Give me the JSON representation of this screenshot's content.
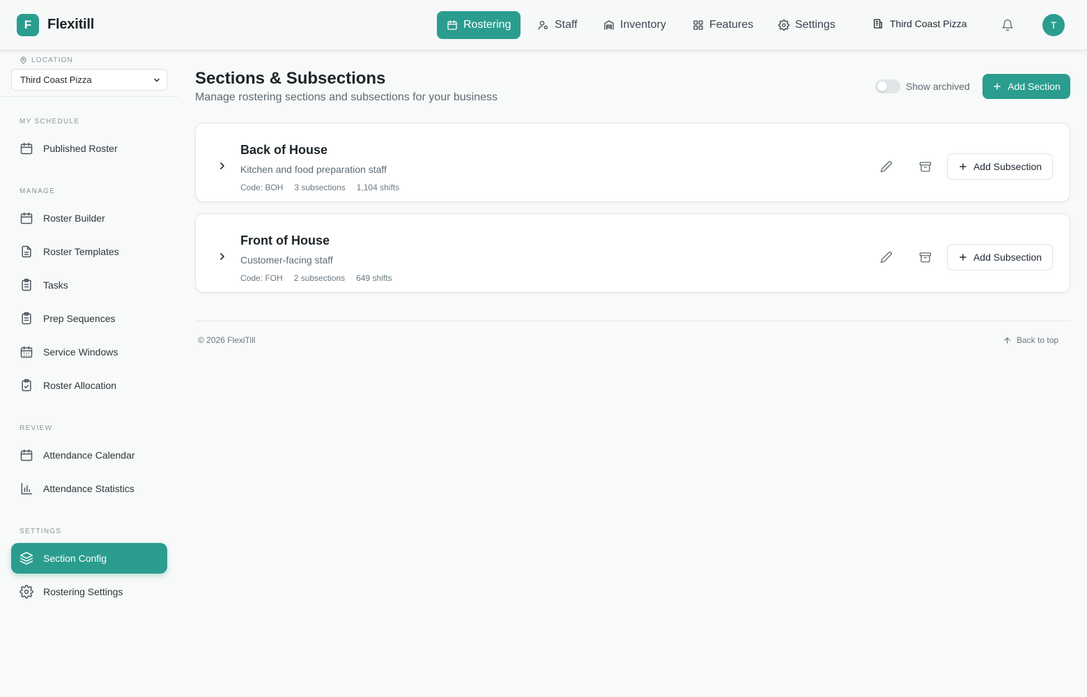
{
  "app": {
    "logo_letter": "F",
    "name": "Flexitill"
  },
  "topnav": {
    "items": [
      {
        "label": "Rostering",
        "icon": "calendar-icon",
        "active": true
      },
      {
        "label": "Staff",
        "icon": "user-icon",
        "active": false
      },
      {
        "label": "Inventory",
        "icon": "warehouse-icon",
        "active": false
      },
      {
        "label": "Features",
        "icon": "grid-icon",
        "active": false
      },
      {
        "label": "Settings",
        "icon": "gear-icon",
        "active": false
      }
    ],
    "business": "Third Coast Pizza",
    "avatar_initial": "T"
  },
  "sidebar": {
    "location_label": "LOCATION",
    "location_value": "Third Coast Pizza",
    "sections": [
      {
        "label": "MY SCHEDULE",
        "items": [
          {
            "label": "Published Roster",
            "icon": "calendar-icon"
          }
        ]
      },
      {
        "label": "MANAGE",
        "items": [
          {
            "label": "Roster Builder",
            "icon": "calendar-icon"
          },
          {
            "label": "Roster Templates",
            "icon": "file-icon"
          },
          {
            "label": "Tasks",
            "icon": "clipboard-list-icon"
          },
          {
            "label": "Prep Sequences",
            "icon": "clipboard-list-icon"
          },
          {
            "label": "Service Windows",
            "icon": "calendar-grid-icon"
          },
          {
            "label": "Roster Allocation",
            "icon": "clipboard-check-icon"
          }
        ]
      },
      {
        "label": "REVIEW",
        "items": [
          {
            "label": "Attendance Calendar",
            "icon": "calendar-icon"
          },
          {
            "label": "Attendance Statistics",
            "icon": "bar-chart-icon"
          }
        ]
      },
      {
        "label": "SETTINGS",
        "items": [
          {
            "label": "Section Config",
            "icon": "layers-icon",
            "active": true
          },
          {
            "label": "Rostering Settings",
            "icon": "gear-icon"
          }
        ]
      }
    ]
  },
  "main": {
    "title": "Sections & Subsections",
    "subtitle": "Manage rostering sections and subsections for your business",
    "show_archived_label": "Show archived",
    "show_archived": false,
    "add_section_label": "Add Section",
    "sections": [
      {
        "name": "Back of House",
        "description": "Kitchen and food preparation staff",
        "code": "Code: BOH",
        "subsections": "3 subsections",
        "shifts": "1,104 shifts",
        "add_label": "Add Subsection"
      },
      {
        "name": "Front of House",
        "description": "Customer-facing staff",
        "code": "Code: FOH",
        "subsections": "2 subsections",
        "shifts": "649 shifts",
        "add_label": "Add Subsection"
      }
    ]
  },
  "footer": {
    "copyright": "© 2026 FlexiTill",
    "back_to_top": "Back to top"
  },
  "colors": {
    "accent": "#2a9d8f",
    "background": "#f8f9f9",
    "text": "#1b2428"
  }
}
